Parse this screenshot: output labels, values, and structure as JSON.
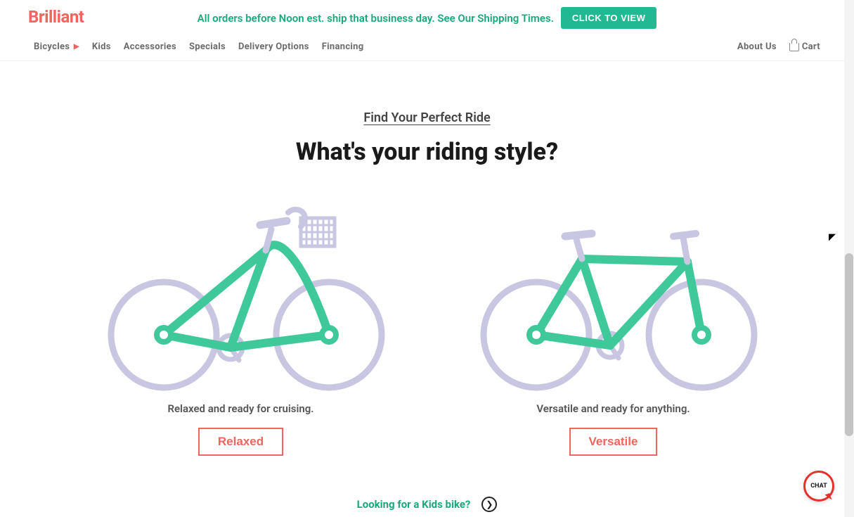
{
  "brand": "Brilliant",
  "banner": {
    "text": "All orders before Noon est. ship that business day. See Our Shipping Times.",
    "button": "CLICK TO VIEW"
  },
  "nav": {
    "bicycles": "Bicycles",
    "kids": "Kids",
    "accessories": "Accessories",
    "specials": "Specials",
    "delivery": "Delivery Options",
    "financing": "Financing",
    "about": "About Us",
    "cart": "Cart"
  },
  "finder": {
    "link": "Find Your Perfect Ride",
    "headline": "What's your riding style?"
  },
  "options": {
    "relaxed": {
      "desc": "Relaxed and ready for cruising.",
      "label": "Relaxed"
    },
    "versatile": {
      "desc": "Versatile and ready for anything.",
      "label": "Versatile"
    }
  },
  "kids_prompt": "Looking for a Kids bike?",
  "chat_label": "CHAT",
  "colors": {
    "brand": "#f0655e",
    "accent_green": "#23b894",
    "bike_frame": "#3fc99a",
    "bike_outline": "#c8c6e0"
  }
}
